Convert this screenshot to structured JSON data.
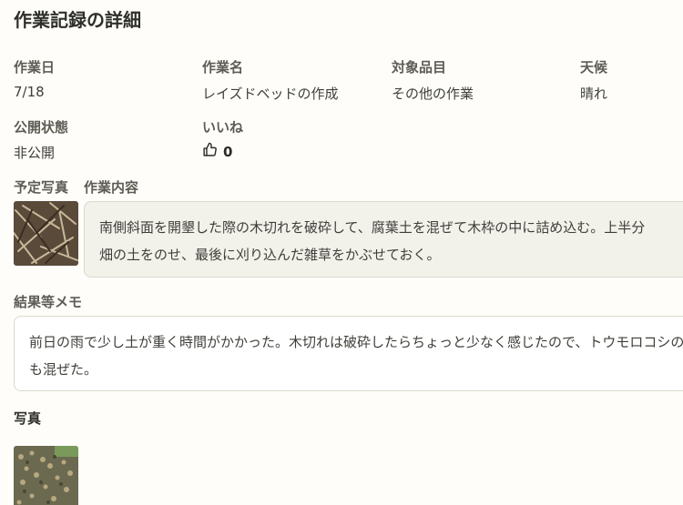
{
  "page_title": "作業記録の詳細",
  "fields": {
    "work_date": {
      "label": "作業日",
      "value": "7/18"
    },
    "work_name": {
      "label": "作業名",
      "value": "レイズドベッドの作成"
    },
    "target_item": {
      "label": "対象品目",
      "value": "その他の作業"
    },
    "weather": {
      "label": "天候",
      "value": "晴れ"
    },
    "visibility": {
      "label": "公開状態",
      "value": "非公開"
    },
    "likes": {
      "label": "いいね",
      "count": "0"
    }
  },
  "planned_photo": {
    "label": "予定写真"
  },
  "work_content": {
    "label": "作業内容",
    "lines": [
      "南側斜面を開墾した際の木切れを破砕して、腐葉土を混ぜて木枠の中に詰め込む。上半分",
      "畑の土をのせ、最後に刈り込んだ雑草をかぶせておく。"
    ]
  },
  "result_memo": {
    "label": "結果等メモ",
    "lines": [
      "前日の雨で少し土が重く時間がかかった。木切れは破砕したらちょっと少なく感じたので、トウモロコシの茎",
      "も混ぜた。"
    ]
  },
  "photos": {
    "label": "写真"
  },
  "icons": {
    "like": "thumbs-up-icon"
  },
  "colors": {
    "content_box_bg": "#f2f1ea",
    "memo_box_bg": "#ffffff",
    "border": "#d9d8cd"
  }
}
